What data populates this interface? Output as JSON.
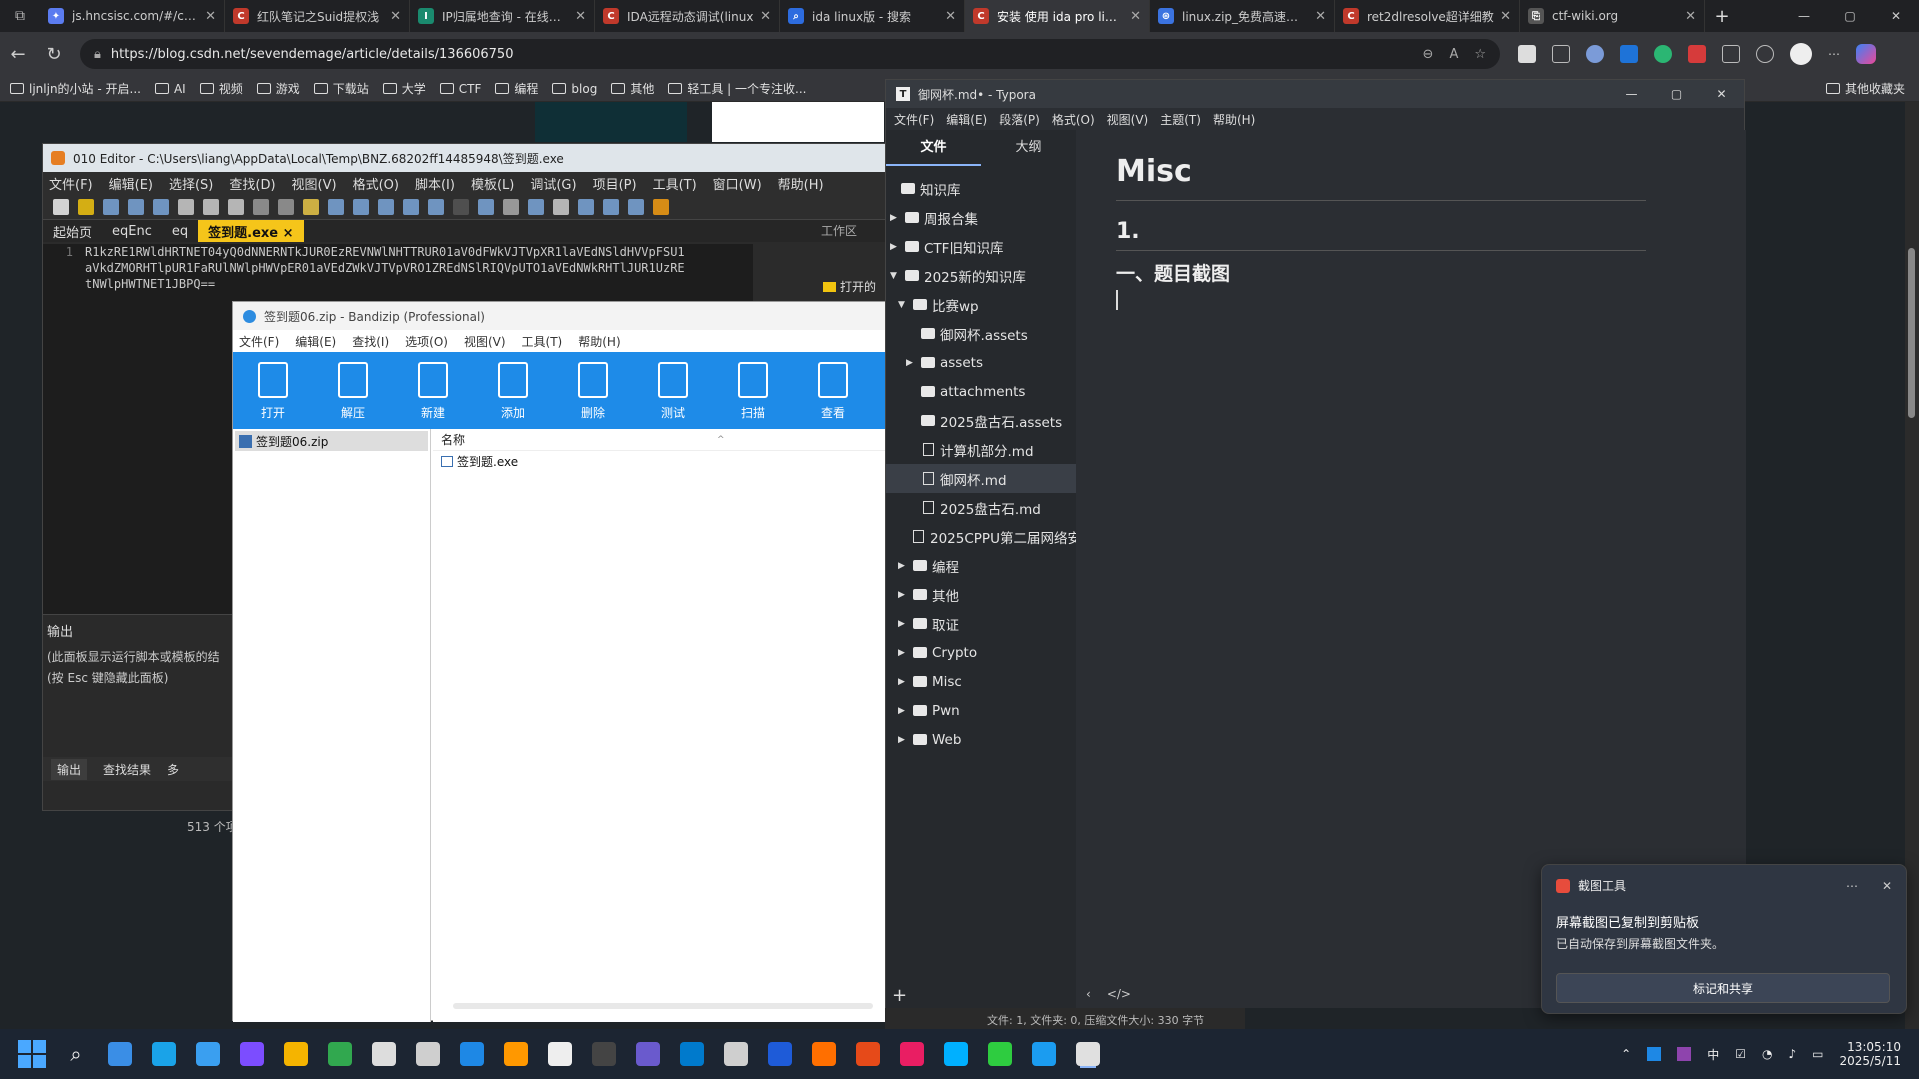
{
  "browser": {
    "tabs": [
      {
        "label": "js.hncsisc.com/#/comp",
        "color": "#5b7cf0",
        "glyph": "✦"
      },
      {
        "label": "红队笔记之Suid提权浅",
        "color": "#c0392b",
        "glyph": "C"
      },
      {
        "label": "IP归属地查询 - 在线工具",
        "color": "#1a8a6e",
        "glyph": "I"
      },
      {
        "label": "IDA远程动态调试(linux",
        "color": "#c0392b",
        "glyph": "C"
      },
      {
        "label": "ida linux版 - 搜索",
        "color": "#2d6cdf",
        "glyph": "⌕"
      },
      {
        "label": "安装 使用 ida pro linux",
        "color": "#c0392b",
        "glyph": "C"
      },
      {
        "label": "linux.zip_免费高速下载",
        "color": "#3b73e0",
        "glyph": "⊛"
      },
      {
        "label": "ret2dlresolve超详细教",
        "color": "#c0392b",
        "glyph": "C"
      },
      {
        "label": "ctf-wiki.org",
        "color": "#555555",
        "glyph": "⎘"
      }
    ],
    "active_tab_index": 5,
    "url": "https://blog.csdn.net/sevendemage/article/details/136606750",
    "bookmarks": [
      "ljnljn的小站 - 开启...",
      "AI",
      "视频",
      "游戏",
      "下载站",
      "大学",
      "CTF",
      "编程",
      "blog",
      "其他",
      "轻工具 | 一个专注收..."
    ],
    "bookmarks_right": "其他收藏夹"
  },
  "editor010": {
    "title": "010 Editor - C:\\Users\\liang\\AppData\\Local\\Temp\\BNZ.68202ff14485948\\签到题.exe",
    "menu": [
      "文件(F)",
      "编辑(E)",
      "选择(S)",
      "查找(D)",
      "视图(V)",
      "格式(O)",
      "脚本(I)",
      "模板(L)",
      "调试(G)",
      "项目(P)",
      "工具(T)",
      "窗口(W)",
      "帮助(H)"
    ],
    "tabs": [
      "起始页",
      "eqEnc",
      "eq",
      "签到题.exe ×"
    ],
    "workspace_label": "工作区",
    "open_label": "打开的",
    "lines": [
      {
        "n": "1",
        "text": "R1kzRE1RWldHRTNET04yQ0dNNERNTkJUR0EzREVNWlNHTTRUR01aV0dFWkVJTVpXR1laVEdNSldHVVpFSU1"
      },
      {
        "n": "",
        "text": "aVkdZMORHTlpUR1FaRUlNWlpHWVpER01aVEdZWkVJTVpVRO1ZREdNSlRIQVpUTO1aVEdNWkRHTlJUR1UzRE"
      },
      {
        "n": "",
        "text": "tNWlpHWTNET1JBPQ=="
      }
    ],
    "output_title": "输出",
    "output_text1": "(此面板显示运行脚本或模板的结",
    "output_text2": "(按 Esc 键隐藏此面板)",
    "output_tabs": [
      "输出",
      "查找结果",
      "多"
    ],
    "explorer_count": "513 个项"
  },
  "bandizip": {
    "title": "签到题06.zip - Bandizip (Professional)",
    "menu": [
      "文件(F)",
      "编辑(E)",
      "查找(I)",
      "选项(O)",
      "视图(V)",
      "工具(T)",
      "帮助(H)"
    ],
    "tools": [
      "打开",
      "解压",
      "新建",
      "添加",
      "删除",
      "测试",
      "扫描",
      "查看"
    ],
    "archive": "签到题06.zip",
    "col_name": "名称",
    "files": [
      "签到题.exe"
    ]
  },
  "typora": {
    "title": "御网杯.md• - Typora",
    "menu": [
      "文件(F)",
      "编辑(E)",
      "段落(P)",
      "格式(O)",
      "视图(V)",
      "主题(T)",
      "帮助(H)"
    ],
    "side_tabs": [
      "文件",
      "大纲"
    ],
    "tree": [
      {
        "label": "知识库",
        "kind": "root"
      },
      {
        "label": "周报合集",
        "kind": "folder",
        "lvl": 0
      },
      {
        "label": "CTF旧知识库",
        "kind": "folder",
        "lvl": 0
      },
      {
        "label": "2025新的知识库",
        "kind": "folder-open",
        "lvl": 0
      },
      {
        "label": "比赛wp",
        "kind": "folder-open",
        "lvl": 1
      },
      {
        "label": "御网杯.assets",
        "kind": "folder-leaf",
        "lvl": 2
      },
      {
        "label": "assets",
        "kind": "folder",
        "lvl": 2
      },
      {
        "label": "attachments",
        "kind": "folder-leaf",
        "lvl": 2
      },
      {
        "label": "2025盘古石.assets",
        "kind": "folder-leaf",
        "lvl": 2
      },
      {
        "label": "计算机部分.md",
        "kind": "doc",
        "lvl": 2
      },
      {
        "label": "御网杯.md",
        "kind": "doc",
        "lvl": 2,
        "selected": true
      },
      {
        "label": "2025盘古石.md",
        "kind": "doc",
        "lvl": 2
      },
      {
        "label": "2025CPPU第二届网络安",
        "kind": "doc",
        "lvl": 2
      },
      {
        "label": "编程",
        "kind": "folder",
        "lvl": 1
      },
      {
        "label": "其他",
        "kind": "folder",
        "lvl": 1
      },
      {
        "label": "取证",
        "kind": "folder",
        "lvl": 1
      },
      {
        "label": "Crypto",
        "kind": "folder",
        "lvl": 1
      },
      {
        "label": "Misc",
        "kind": "folder",
        "lvl": 1
      },
      {
        "label": "Pwn",
        "kind": "folder",
        "lvl": 1
      },
      {
        "label": "Web",
        "kind": "folder",
        "lvl": 1
      }
    ],
    "doc": {
      "h1": "Misc",
      "h2": "1.",
      "h3": "一、题目截图"
    },
    "status": "文件: 1, 文件夹: 0, 压缩文件大小: 330 字节"
  },
  "notification": {
    "app": "截图工具",
    "title": "屏幕截图已复制到剪贴板",
    "body": "已自动保存到屏幕截图文件夹。",
    "action": "标记和共享"
  },
  "taskbar": {
    "time": "13:05:10",
    "date": "2025/5/11",
    "ime": "中",
    "icon_colors": [
      "#3a8ee6",
      "#1aa3e8",
      "#3a9ff0",
      "#7c4dff",
      "#f5b400",
      "#31a84f",
      "#dddddd",
      "#cfcfcf",
      "#1e88e5",
      "#ff9800",
      "#eeeeee",
      "#444444",
      "#6a5acd",
      "#007acc",
      "#cfcfcf",
      "#1e5bd8",
      "#ff6f00",
      "#e64a19",
      "#e91e63",
      "#00b0ff",
      "#2ecc40",
      "#1b9cf0",
      "#e0e0e0"
    ]
  }
}
